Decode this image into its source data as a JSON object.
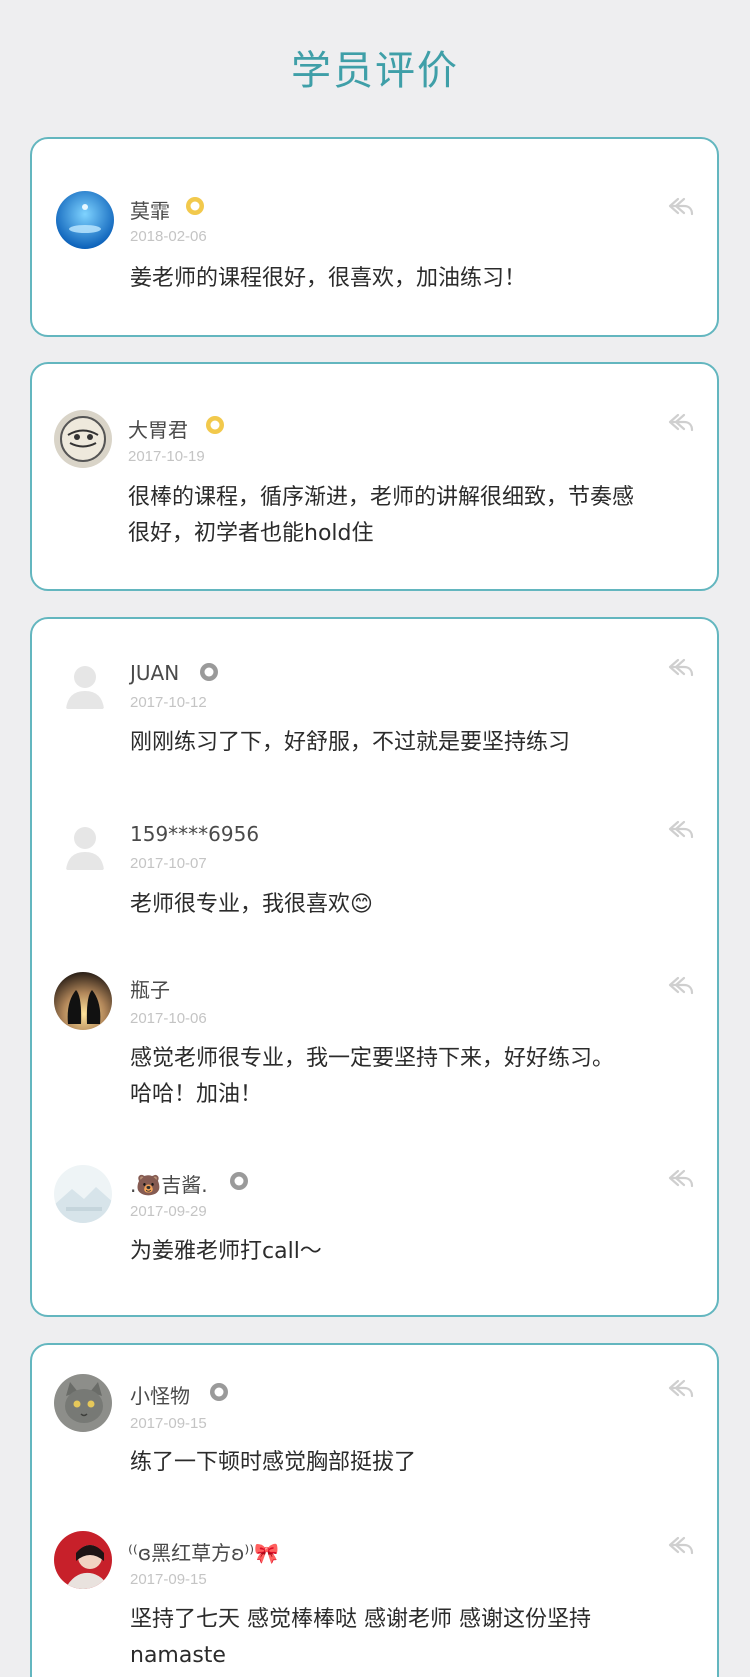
{
  "page": {
    "title": "学员评价"
  },
  "cards": [
    {
      "reviews": [
        {
          "name": "莫霏",
          "date": "2018-02-06",
          "badge": "gold",
          "avatar": "water-drop",
          "text": [
            "姜老师的课程很好，很喜欢，加油练习！"
          ]
        }
      ]
    },
    {
      "reviews": [
        {
          "name": "大胃君",
          "date": "2017-10-19",
          "badge": "gold",
          "avatar": "sketch",
          "text": [
            "很棒的课程，循序渐进，老师的讲解很细致，节奏感",
            "很好，初学者也能hold住"
          ]
        }
      ]
    },
    {
      "reviews": [
        {
          "name": "JUAN",
          "date": "2017-10-12",
          "badge": "gray",
          "avatar": "default-person",
          "text": [
            "刚刚练习了下，好舒服，不过就是要坚持练习"
          ]
        },
        {
          "name": "159****6956",
          "date": "2017-10-07",
          "badge": "none",
          "avatar": "default-person",
          "text": [
            "老师很专业，我很喜欢😊"
          ]
        },
        {
          "name": "瓶子",
          "date": "2017-10-06",
          "badge": "none",
          "avatar": "penguins",
          "text": [
            "感觉老师很专业，我一定要坚持下来，好好练习。",
            "哈哈！加油！"
          ]
        },
        {
          "name": ".🐻吉酱.",
          "date": "2017-09-29",
          "badge": "gray",
          "avatar": "landscape",
          "text": [
            "为姜雅老师打call～"
          ]
        }
      ]
    },
    {
      "reviews": [
        {
          "name": "小怪物",
          "date": "2017-09-15",
          "badge": "gray",
          "avatar": "cat",
          "text": [
            "练了一下顿时感觉胸部挺拔了"
          ]
        },
        {
          "name": "⁽⁽ɞ黑红草方ʚ⁾⁾🎀",
          "date": "2017-09-15",
          "badge": "none",
          "avatar": "red-photo",
          "text": [
            "坚持了七天 感觉棒棒哒 感谢老师 感谢这份坚持",
            "namaste"
          ]
        }
      ]
    }
  ],
  "colors": {
    "accent": "#3f9fa8",
    "border": "#63b6bf",
    "gold_badge": "#f2c94c",
    "gray_badge": "#9a9a9a"
  }
}
